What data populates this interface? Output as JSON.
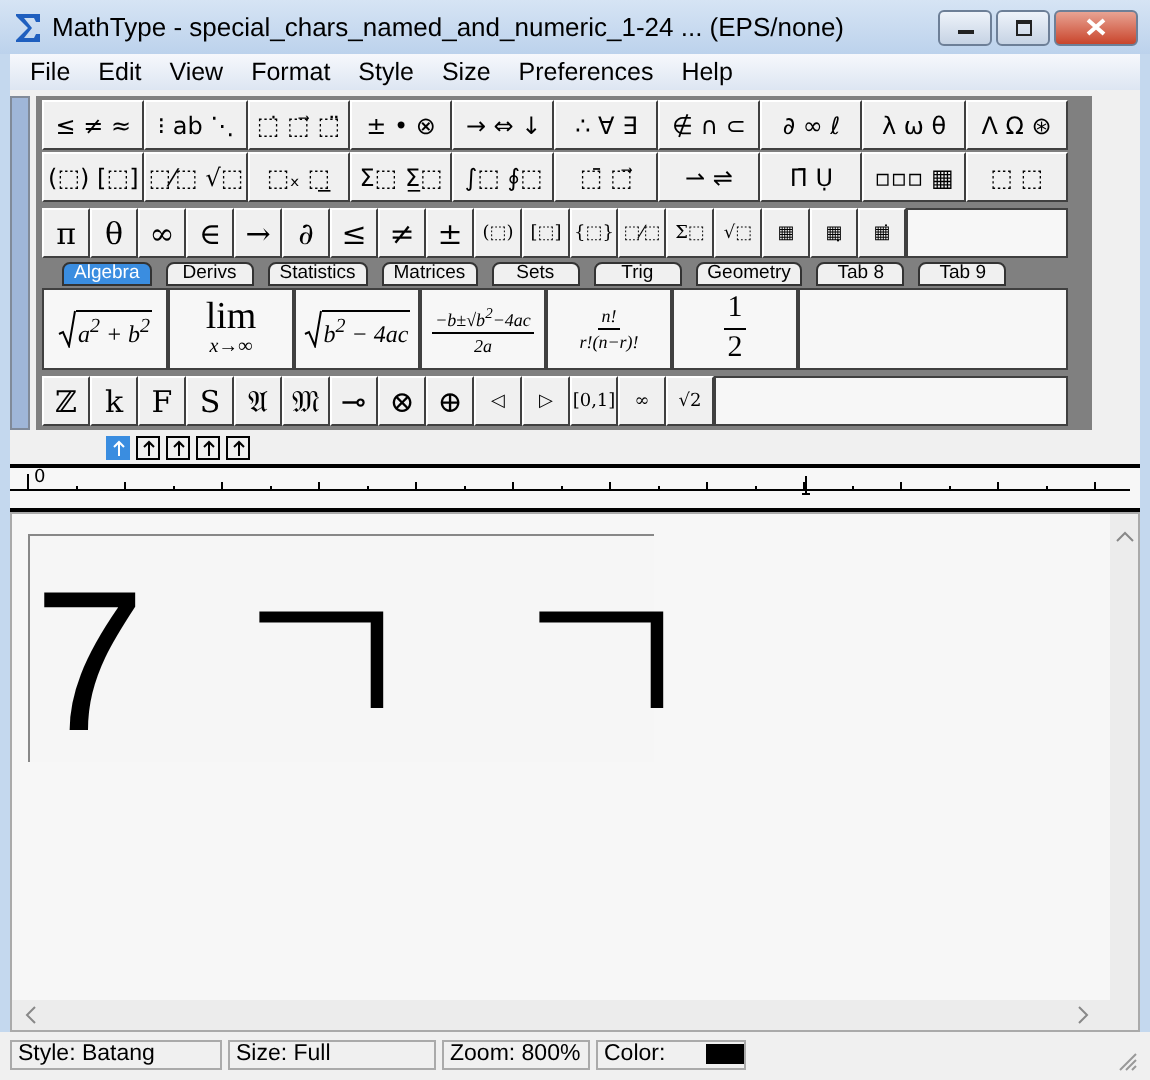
{
  "window": {
    "title": "MathType - special_chars_named_and_numeric_1-24 ... (EPS/none)"
  },
  "menu": [
    "File",
    "Edit",
    "View",
    "Format",
    "Style",
    "Size",
    "Preferences",
    "Help"
  ],
  "palette_rows": [
    [
      "≤ ≠ ≈",
      "⁝ ab ⋱",
      "⬚̇ ⬚⃗ ⬚̈",
      "± • ⊗",
      "→ ⇔ ↓",
      "∴ ∀ ∃",
      "∉ ∩ ⊂",
      "∂ ∞ ℓ",
      "λ ω θ",
      "Λ Ω ⊛"
    ],
    [
      "(⬚) [⬚]",
      "⬚⁄⬚ √⬚",
      "⬚ₓ ⬚̲",
      "Σ⬚ Σ̲⬚",
      "∫⬚ ∮⬚",
      "⬚̄ ⬚⃗",
      "⇀ ⇌",
      "Π̄ Ụ",
      "▫▫▫ ▦",
      "⬚ ⬚"
    ]
  ],
  "symbol_bar": [
    "π",
    "θ",
    "∞",
    "∈",
    "→",
    "∂",
    "≤",
    "≠",
    "±",
    "(⬚)",
    "[⬚]",
    "{⬚}",
    "⬚⁄⬚",
    "Σ⬚",
    "√⬚",
    "▦",
    "▦̣",
    "▦̇"
  ],
  "tabs": [
    {
      "label": "Algebra",
      "selected": true
    },
    {
      "label": "Derivs",
      "selected": false
    },
    {
      "label": "Statistics",
      "selected": false
    },
    {
      "label": "Matrices",
      "selected": false
    },
    {
      "label": "Sets",
      "selected": false
    },
    {
      "label": "Trig",
      "selected": false
    },
    {
      "label": "Geometry",
      "selected": false
    },
    {
      "label": "Tab 8",
      "selected": false
    },
    {
      "label": "Tab 9",
      "selected": false
    }
  ],
  "templates": [
    {
      "kind": "sqrt",
      "body": "a$^{2}$ + b$^{2}$"
    },
    {
      "kind": "lim",
      "top": "lim",
      "bottom": "x→∞"
    },
    {
      "kind": "sqrt",
      "body": "b$^{2}$ − 4ac"
    },
    {
      "kind": "frac",
      "num": "−b±√b$^{2}$−4ac",
      "den": "2a"
    },
    {
      "kind": "frac",
      "num": "n!",
      "den": "r!(n−r)!"
    },
    {
      "kind": "frac",
      "num": "1",
      "den": "2"
    }
  ],
  "tab_symbols": [
    "ℤ",
    "k",
    "F",
    "S",
    "𝔄",
    "𝔐",
    "⊸",
    "⊗",
    "⊕",
    "◁",
    "▷",
    "[0,1]",
    "∞",
    "√2"
  ],
  "spacing_buttons": [
    {
      "selected": true
    },
    {
      "selected": false
    },
    {
      "selected": false
    },
    {
      "selected": false
    },
    {
      "selected": false
    }
  ],
  "ruler": {
    "origin_label": "0"
  },
  "document": {
    "glyphs": [
      "7",
      "ㄱ",
      "ㄱ"
    ]
  },
  "status_bar": [
    "Style: Batang",
    "Size: Full",
    "Zoom: 800%",
    "Color:"
  ]
}
